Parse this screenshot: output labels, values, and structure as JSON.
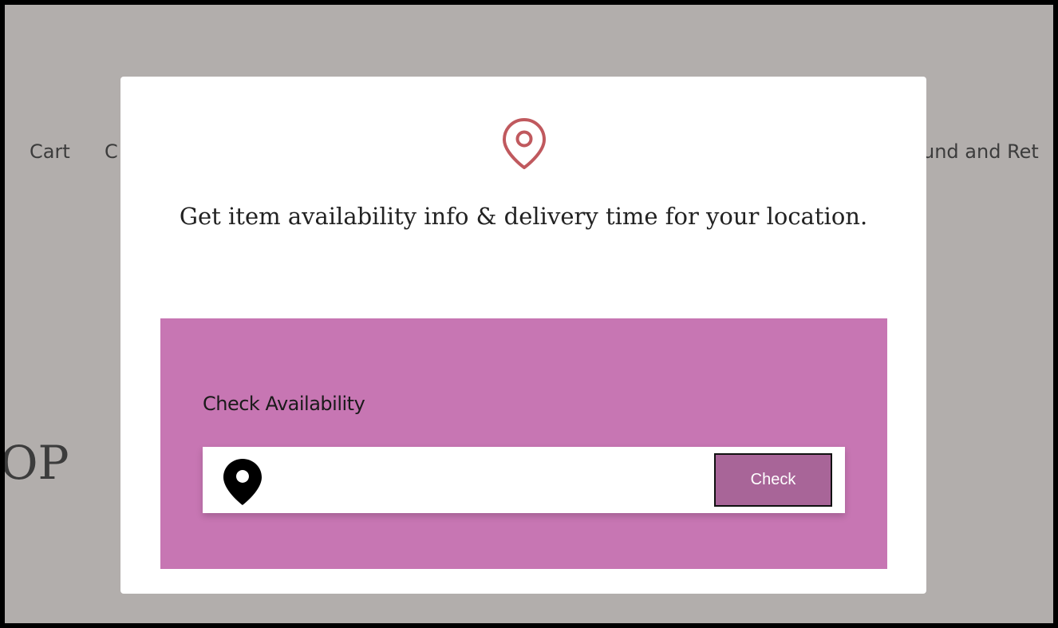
{
  "background": {
    "nav": {
      "cart": "Cart",
      "partial_left": "C",
      "partial_right": "und and Ret"
    },
    "site_title_partial": "OP"
  },
  "modal": {
    "icon": "location-pin-outline-icon",
    "heading": "Get item availability info & delivery time for your location.",
    "panel": {
      "title": "Check Availability",
      "input": {
        "icon": "location-pin-solid-icon",
        "value": "",
        "placeholder": ""
      },
      "check_label": "Check"
    }
  },
  "colors": {
    "overlay": "#b2aeac",
    "accent_icon": "#c0595e",
    "panel": "#c776b3",
    "button": "#a86598"
  }
}
